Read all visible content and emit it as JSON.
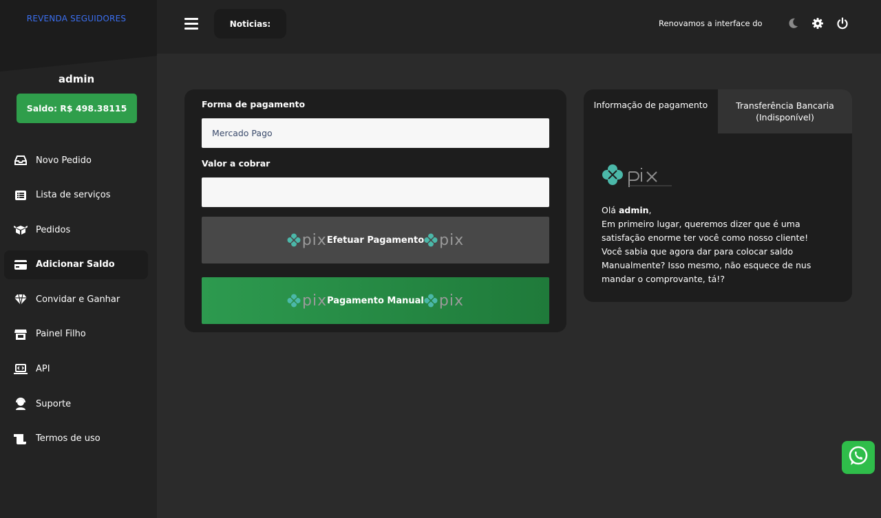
{
  "brand": "REVENDA SEGUIDORES",
  "user": {
    "name": "admin",
    "balance": "Saldo: R$ 498.38115"
  },
  "nav": [
    {
      "label": "Novo Pedido",
      "icon": "inbox-icon"
    },
    {
      "label": "Lista de serviços",
      "icon": "list-icon"
    },
    {
      "label": "Pedidos",
      "icon": "box-icon"
    },
    {
      "label": "Adicionar Saldo",
      "icon": "credit-card-icon",
      "active": true
    },
    {
      "label": "Convidar e Ganhar",
      "icon": "diamond-icon"
    },
    {
      "label": "Painel Filho",
      "icon": "store-icon"
    },
    {
      "label": "API",
      "icon": "code-laptop-icon"
    },
    {
      "label": "Suporte",
      "icon": "headset-icon"
    },
    {
      "label": "Termos de uso",
      "icon": "scroll-icon"
    }
  ],
  "header": {
    "news_label": "Noticias:",
    "ticker": "Renovamos a interface do painel"
  },
  "payment": {
    "method_label": "Forma de pagamento",
    "method_value": "Mercado Pago",
    "amount_label": "Valor a cobrar",
    "amount_value": "",
    "pix_word": "pix",
    "pay_button": "Efetuar Pagamento",
    "manual_button": "Pagamento Manual"
  },
  "info": {
    "tab_info": "Informação de pagamento",
    "tab_transfer_line1": "Transferência Bancaria",
    "tab_transfer_line2": "(Indisponível)",
    "greeting_prefix": "Olá ",
    "greeting_name": "admin",
    "greeting_suffix": ",",
    "line1": "Em primeiro lugar, queremos dizer que é uma satisfação enorme ter você como nosso cliente!",
    "line2": "Você sabia que agora dar para colocar saldo Manualmente? Isso mesmo, não esquece de nus mandar o comprovante, tá!?"
  },
  "colors": {
    "accent_green": "#2f9e4b",
    "brand_blue": "#3b6ff0",
    "pix_teal": "#4bb8a9"
  }
}
